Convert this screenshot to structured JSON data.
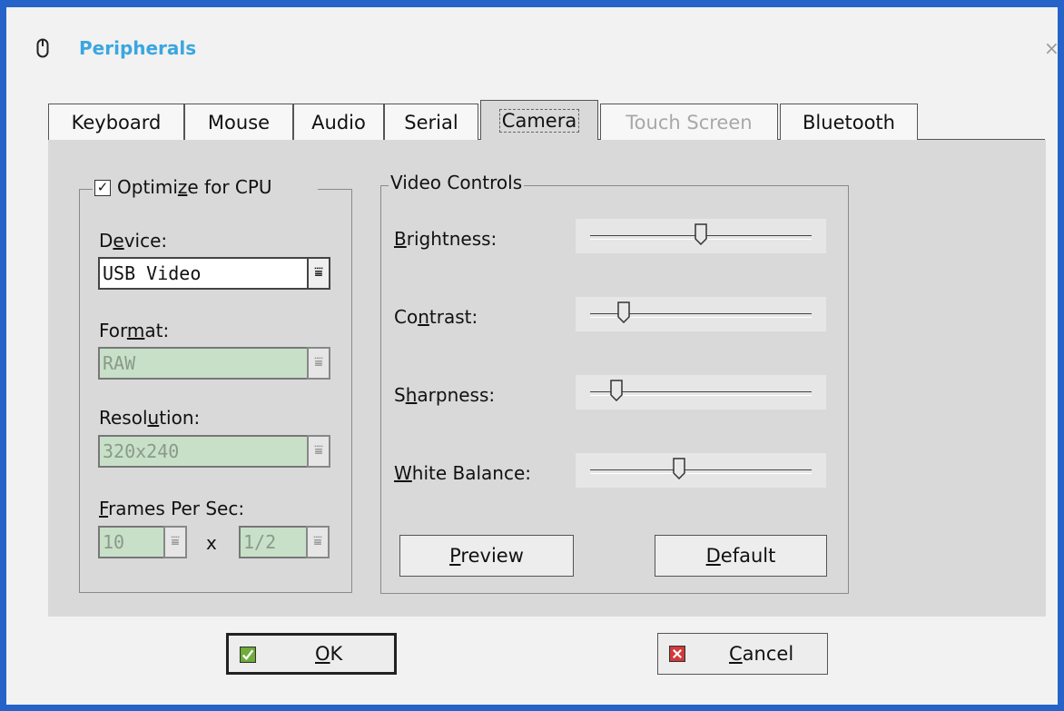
{
  "dialog": {
    "title": "Peripherals",
    "close_glyph": "×",
    "icon": "mouse-icon"
  },
  "tabs": [
    {
      "label": "Keyboard",
      "state": "normal"
    },
    {
      "label": "Mouse",
      "state": "normal"
    },
    {
      "label": "Audio",
      "state": "normal"
    },
    {
      "label": "Serial",
      "state": "normal"
    },
    {
      "label": "Camera",
      "state": "active"
    },
    {
      "label": "Touch Screen",
      "state": "disabled"
    },
    {
      "label": "Bluetooth",
      "state": "normal"
    }
  ],
  "camera": {
    "optimize": {
      "label": "Optimize for CPU",
      "checked": true,
      "check_glyph": "✓"
    },
    "device": {
      "label": "Device:",
      "value": "USB Video"
    },
    "format": {
      "label": "Format:",
      "value": "RAW"
    },
    "resolution": {
      "label": "Resolution:",
      "value": "320x240"
    },
    "fps": {
      "label": "Frames Per Sec:",
      "value": "10",
      "separator": "x",
      "divider": "1/2"
    },
    "combo_glyph": "⩸",
    "video_controls": {
      "title": "Video Controls",
      "sliders": [
        {
          "label": "Brightness:",
          "level": 0.5
        },
        {
          "label": "Contrast:",
          "level": 0.15
        },
        {
          "label": "Sharpness:",
          "level": 0.12
        },
        {
          "label": "White Balance:",
          "level": 0.4
        }
      ],
      "preview_label": "Preview",
      "default_label": "Default"
    }
  },
  "footer": {
    "ok_label": "OK",
    "cancel_label": "Cancel"
  },
  "colors": {
    "accent": "#2563c9",
    "title": "#3aa6e0",
    "panel": "#d9d9d9",
    "disabled_field": "#c8e0c8"
  }
}
